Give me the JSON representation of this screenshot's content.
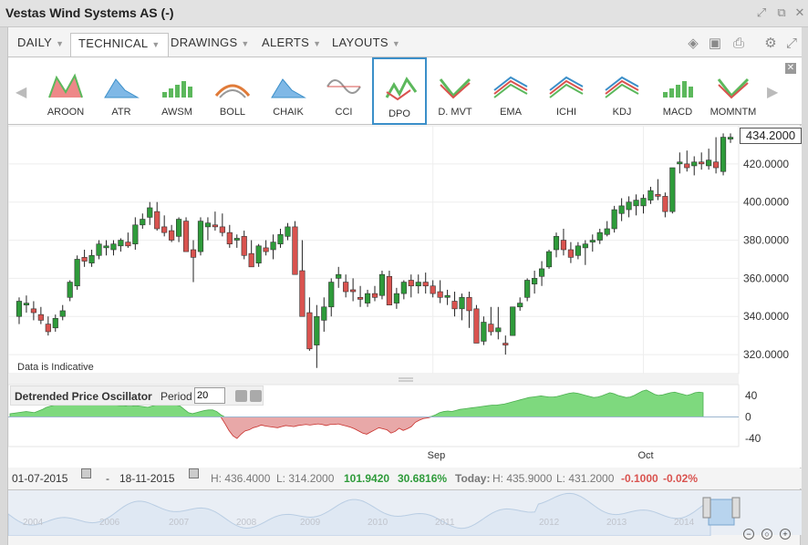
{
  "window": {
    "title": "Vestas Wind Systems AS (-)"
  },
  "menu": [
    {
      "label": "DAILY",
      "active": false
    },
    {
      "label": "TECHNICAL",
      "active": true
    },
    {
      "label": "DRAWINGS",
      "active": false
    },
    {
      "label": "ALERTS",
      "active": false
    },
    {
      "label": "LAYOUTS",
      "active": false
    }
  ],
  "indicators": [
    "AROON",
    "ATR",
    "AWSM",
    "BOLL",
    "CHAIK",
    "CCI",
    "DPO",
    "D. MVT",
    "EMA",
    "ICHI",
    "KDJ",
    "MACD",
    "MOMNTM"
  ],
  "selected_indicator": "DPO",
  "price_tag": "434.2000",
  "data_note": "Data is Indicative",
  "dpo_panel": {
    "name": "Detrended Price Oscillator",
    "period_label": "Period",
    "period_value": "20"
  },
  "status": {
    "from": "01-07-2015",
    "sep": "-",
    "to": "18-11-2015",
    "high": "H: 436.4000",
    "low": "L: 314.2000",
    "change": "101.9420",
    "change_pct": "30.6816%",
    "today_label": "Today:",
    "today_high": "H: 435.9000",
    "today_low": "L: 431.2000",
    "today_change": "-0.1000",
    "today_pct": "-0.02%"
  },
  "navigator": {
    "years": [
      "2004",
      "2006",
      "2007",
      "2008",
      "2009",
      "2010",
      "2011",
      "2012",
      "2013",
      "2014",
      "2015"
    ]
  },
  "colors": {
    "up": "#2e9b3a",
    "down": "#d9534f",
    "dpo_pos": "#7ed97e",
    "dpo_neg": "#e8a8a8",
    "accent": "#3b8fc9"
  },
  "chart_data": [
    {
      "type": "candlestick",
      "ylim": [
        310,
        440
      ],
      "yticks": [
        "420.0000",
        "400.0000",
        "380.0000",
        "360.0000",
        "340.0000",
        "320.0000"
      ],
      "ytick_values": [
        420,
        400,
        380,
        360,
        340,
        320
      ],
      "xticks": [
        "Sep",
        "Oct"
      ],
      "xtick_index": [
        57,
        86
      ],
      "ohlc": [
        [
          340,
          350,
          336,
          348
        ],
        [
          346,
          351,
          342,
          347
        ],
        [
          344,
          348,
          338,
          342
        ],
        [
          341,
          345,
          336,
          338
        ],
        [
          336,
          340,
          330,
          332
        ],
        [
          334,
          341,
          332,
          339
        ],
        [
          340,
          346,
          338,
          343
        ],
        [
          350,
          359,
          348,
          358
        ],
        [
          356,
          372,
          354,
          370
        ],
        [
          371,
          375,
          366,
          369
        ],
        [
          368,
          375,
          366,
          372
        ],
        [
          372,
          380,
          370,
          378
        ],
        [
          376,
          380,
          372,
          377
        ],
        [
          375,
          380,
          372,
          378
        ],
        [
          377,
          381,
          374,
          380
        ],
        [
          379,
          384,
          376,
          377
        ],
        [
          378,
          392,
          375,
          388
        ],
        [
          388,
          394,
          386,
          391
        ],
        [
          392,
          400,
          388,
          397
        ],
        [
          395,
          400,
          385,
          386
        ],
        [
          387,
          393,
          382,
          384
        ],
        [
          385,
          388,
          379,
          380
        ],
        [
          382,
          392,
          379,
          391
        ],
        [
          390,
          392,
          374,
          374
        ],
        [
          375,
          380,
          358,
          371
        ],
        [
          374,
          392,
          372,
          390
        ],
        [
          387,
          392,
          380,
          389
        ],
        [
          388,
          395,
          385,
          387
        ],
        [
          387,
          394,
          382,
          384
        ],
        [
          384,
          388,
          376,
          378
        ],
        [
          380,
          383,
          376,
          381
        ],
        [
          382,
          385,
          370,
          372
        ],
        [
          373,
          380,
          366,
          366
        ],
        [
          368,
          378,
          366,
          377
        ],
        [
          376,
          380,
          372,
          374
        ],
        [
          375,
          383,
          370,
          379
        ],
        [
          378,
          386,
          376,
          383
        ],
        [
          382,
          389,
          380,
          387
        ],
        [
          387,
          390,
          362,
          362
        ],
        [
          364,
          380,
          340,
          340
        ],
        [
          342,
          350,
          322,
          323
        ],
        [
          325,
          346,
          313,
          340
        ],
        [
          338,
          350,
          332,
          345
        ],
        [
          345,
          360,
          340,
          358
        ],
        [
          360,
          366,
          355,
          362
        ],
        [
          358,
          362,
          350,
          353
        ],
        [
          354,
          360,
          348,
          353
        ],
        [
          350,
          356,
          345,
          349
        ],
        [
          347,
          354,
          345,
          352
        ],
        [
          352,
          356,
          348,
          350
        ],
        [
          351,
          364,
          349,
          362
        ],
        [
          361,
          364,
          346,
          346
        ],
        [
          347,
          355,
          344,
          352
        ],
        [
          352,
          359,
          349,
          358
        ],
        [
          359,
          362,
          350,
          356
        ],
        [
          356,
          362,
          352,
          358
        ],
        [
          358,
          363,
          352,
          356
        ],
        [
          356,
          359,
          350,
          352
        ],
        [
          353,
          359,
          347,
          350
        ],
        [
          350,
          354,
          346,
          351
        ],
        [
          348,
          353,
          340,
          344
        ],
        [
          344,
          352,
          338,
          350
        ],
        [
          350,
          353,
          334,
          343
        ],
        [
          344,
          346,
          326,
          326
        ],
        [
          327,
          340,
          325,
          337
        ],
        [
          336,
          345,
          330,
          332
        ],
        [
          332,
          345,
          328,
          334
        ],
        [
          326,
          330,
          320,
          325
        ],
        [
          330,
          345,
          330,
          345
        ],
        [
          345,
          350,
          343,
          347
        ],
        [
          350,
          360,
          348,
          359
        ],
        [
          357,
          364,
          352,
          360
        ],
        [
          361,
          369,
          356,
          365
        ],
        [
          366,
          375,
          365,
          374
        ],
        [
          375,
          384,
          371,
          382
        ],
        [
          380,
          386,
          372,
          375
        ],
        [
          375,
          379,
          368,
          371
        ],
        [
          372,
          379,
          370,
          377
        ],
        [
          376,
          380,
          367,
          378
        ],
        [
          379,
          383,
          374,
          380
        ],
        [
          380,
          386,
          378,
          384
        ],
        [
          383,
          390,
          382,
          386
        ],
        [
          386,
          398,
          384,
          396
        ],
        [
          394,
          402,
          390,
          398
        ],
        [
          396,
          403,
          392,
          400
        ],
        [
          398,
          404,
          393,
          401
        ],
        [
          398,
          404,
          394,
          402
        ],
        [
          401,
          408,
          399,
          406
        ],
        [
          404,
          412,
          401,
          403
        ],
        [
          403,
          405,
          392,
          395
        ],
        [
          395,
          418,
          394,
          418
        ],
        [
          420,
          426,
          415,
          421
        ],
        [
          420,
          427,
          416,
          418
        ],
        [
          419,
          424,
          414,
          421
        ],
        [
          421,
          426,
          417,
          420
        ],
        [
          419,
          428,
          417,
          422
        ],
        [
          421,
          434,
          415,
          418
        ],
        [
          416,
          436,
          414,
          434
        ],
        [
          433,
          436,
          431,
          434
        ]
      ]
    },
    {
      "type": "area",
      "name": "Detrended Price Oscillator",
      "ylim": [
        -55,
        60
      ],
      "yticks": [
        "40",
        "0",
        "-40"
      ],
      "ytick_values": [
        40,
        0,
        -40
      ],
      "values": [
        6,
        7,
        8,
        9,
        10,
        9,
        8,
        11,
        14,
        18,
        20,
        22,
        23,
        24,
        24,
        23,
        23,
        24,
        24,
        23,
        24,
        25,
        25,
        24,
        23,
        22,
        22,
        21,
        21,
        20,
        20,
        21,
        20,
        19,
        18,
        20,
        22,
        24,
        24,
        24,
        23,
        22,
        20,
        14,
        8,
        6,
        8,
        10,
        12,
        13,
        13,
        10,
        4,
        -12,
        -25,
        -35,
        -40,
        -32,
        -26,
        -24,
        -20,
        -18,
        -15,
        -17,
        -18,
        -19,
        -20,
        -18,
        -16,
        -17,
        -18,
        -16,
        -15,
        -14,
        -15,
        -14,
        -13,
        -14,
        -16,
        -14,
        -14,
        -13,
        -15,
        -17,
        -19,
        -22,
        -26,
        -30,
        -32,
        -28,
        -24,
        -20,
        -22,
        -24,
        -30,
        -27,
        -21,
        -25,
        -22,
        -18,
        -10,
        -6,
        -3,
        -2,
        1,
        4,
        8,
        10,
        11,
        10,
        12,
        14,
        15,
        16,
        17,
        18,
        19,
        20,
        21,
        22,
        22,
        23,
        24,
        26,
        28,
        30,
        32,
        34,
        36,
        37,
        38,
        39,
        38,
        37,
        37,
        38,
        40,
        42,
        44,
        45,
        44,
        42,
        40,
        38,
        36,
        37,
        39,
        42,
        45,
        43,
        40,
        38,
        36,
        37,
        40,
        44,
        48,
        50,
        46,
        42,
        40,
        41,
        43,
        45,
        46,
        44,
        42,
        40,
        42,
        45,
        46,
        45
      ]
    }
  ]
}
